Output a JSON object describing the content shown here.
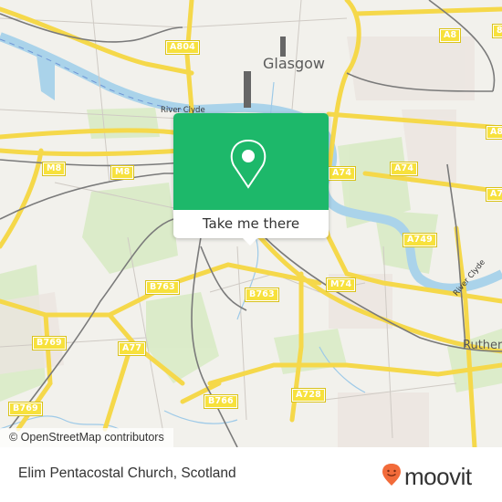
{
  "map": {
    "city_label": "Glasgow",
    "partial_town_label": "Ruther",
    "river_labels": [
      "River Clyde",
      "River Clyde"
    ],
    "road_labels": [
      "A804",
      "A8",
      "M8",
      "M8",
      "A74",
      "A74",
      "A8",
      "A7",
      "A749",
      "M74",
      "B763",
      "B763",
      "B769",
      "A77",
      "B769",
      "B766",
      "A728",
      "8"
    ],
    "attribution": "© OpenStreetMap contributors",
    "colors": {
      "land": "#f2f1ec",
      "water": "#aad3ea",
      "road": "#f7e13c",
      "rail": "#777777",
      "park": "#d6e9c2"
    }
  },
  "popup": {
    "pin_icon": "map-pin-icon",
    "button_label": "Take me there",
    "accent_color": "#1db86a"
  },
  "footer": {
    "place_name": "Elim Pentacostal Church, Scotland",
    "brand": "moovit",
    "brand_color": "#f26b3a"
  }
}
